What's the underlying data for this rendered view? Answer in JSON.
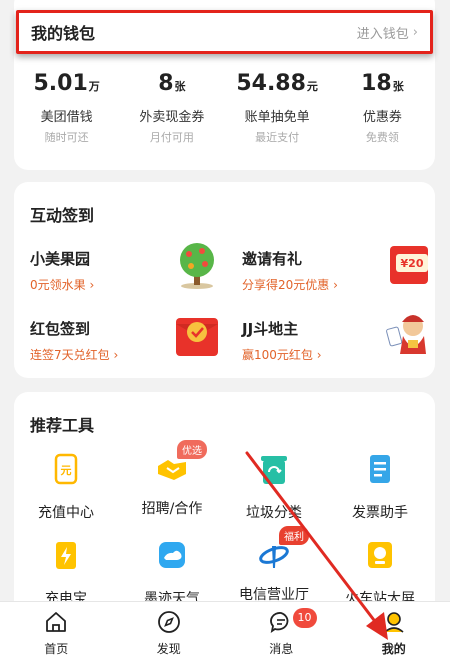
{
  "wallet": {
    "title": "我的钱包",
    "enter_label": "进入钱包",
    "stats": [
      {
        "value": "5.01",
        "unit": "万",
        "label": "美团借钱",
        "sub": "随时可还"
      },
      {
        "value": "8",
        "unit": "张",
        "label": "外卖现金券",
        "sub": "月付可用"
      },
      {
        "value": "54.88",
        "unit": "元",
        "label": "账单抽免单",
        "sub": "最近支付"
      },
      {
        "value": "18",
        "unit": "张",
        "label": "优惠券",
        "sub": "免费领"
      }
    ]
  },
  "checkin": {
    "title": "互动签到",
    "items": [
      {
        "name": "小美果园",
        "sub": "0元领水果",
        "icon": "fruit-tree-icon"
      },
      {
        "name": "邀请有礼",
        "sub": "分享得20元优惠",
        "icon": "red-envelope-20-icon",
        "icon_text": "¥20"
      },
      {
        "name": "红包签到",
        "sub": "连签7天兑红包",
        "icon": "red-packet-check-icon"
      },
      {
        "name": "JJ斗地主",
        "sub": "赢100元红包",
        "icon": "card-game-character-icon"
      }
    ]
  },
  "tools": {
    "title": "推荐工具",
    "items": [
      {
        "label": "充值中心",
        "icon": "recharge-icon",
        "icon_text": "元"
      },
      {
        "label": "招聘/合作",
        "icon": "handshake-icon",
        "tag": "优选"
      },
      {
        "label": "垃圾分类",
        "icon": "trash-bin-icon"
      },
      {
        "label": "发票助手",
        "icon": "invoice-icon"
      },
      {
        "label": "充电宝",
        "icon": "power-bank-icon"
      },
      {
        "label": "墨迹天气",
        "icon": "weather-icon"
      },
      {
        "label": "电信营业厅",
        "icon": "telecom-icon",
        "tag": "福利"
      },
      {
        "label": "火车站大屏",
        "icon": "train-screen-icon"
      }
    ]
  },
  "nav": {
    "items": [
      {
        "label": "首页",
        "icon": "home-icon"
      },
      {
        "label": "发现",
        "icon": "compass-icon"
      },
      {
        "label": "消息",
        "icon": "message-icon",
        "badge": "10"
      },
      {
        "label": "我的",
        "icon": "profile-icon",
        "active": true
      }
    ]
  },
  "colors": {
    "accent": "#ffc300",
    "highlight_border": "#e3231b",
    "orange_text": "#e2632a",
    "badge_red": "#f04a3c"
  }
}
